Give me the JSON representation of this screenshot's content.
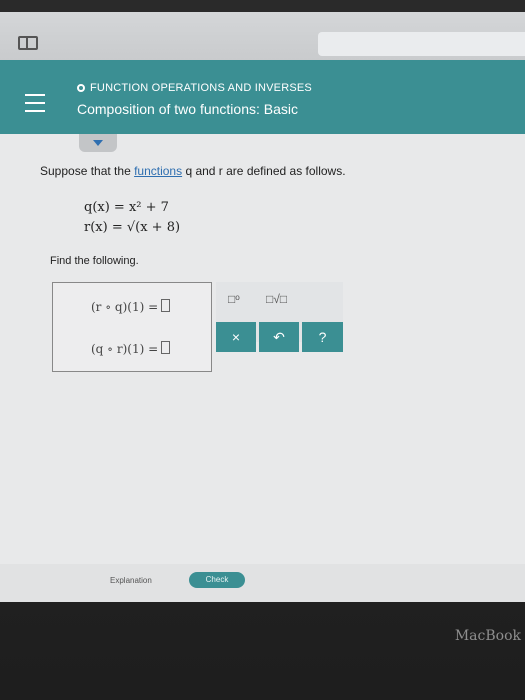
{
  "header": {
    "subheading": "FUNCTION OPERATIONS AND INVERSES",
    "title": "Composition of two functions: Basic"
  },
  "problem": {
    "prompt_pre": "Suppose that the ",
    "prompt_link": "functions",
    "prompt_post": " q and r are defined as follows.",
    "q_def": "q(x) = x² + 7",
    "r_def": "r(x) = √(x + 8)",
    "find": "Find the following."
  },
  "answers": [
    {
      "expr": "(r ∘ q)(1) =",
      "value": ""
    },
    {
      "expr": "(q ∘ r)(1) =",
      "value": ""
    }
  ],
  "tools": {
    "superscript": "□ᵒ",
    "sqrt": "□√□",
    "clear": "×",
    "undo": "↶",
    "help": "?"
  },
  "footer": {
    "explanation": "Explanation",
    "check": "Check"
  },
  "device": {
    "brand": "MacBook"
  }
}
